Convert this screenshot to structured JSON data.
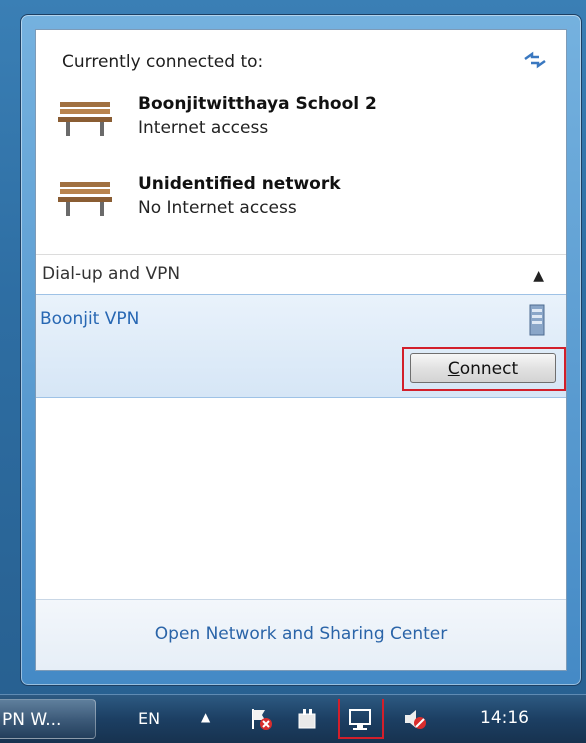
{
  "popup": {
    "current_title": "Currently connected to:",
    "networks": [
      {
        "name": "Boonjitwitthaya School  2",
        "status": "Internet access",
        "icon": "bench-network-icon"
      },
      {
        "name": "Unidentified network",
        "status": "No Internet access",
        "icon": "bench-network-icon"
      }
    ],
    "dialup_label": "Dial-up and VPN",
    "vpn": {
      "name": "Boonjit VPN",
      "button": "Connect",
      "button_accesskey": "C"
    },
    "footer_link": "Open Network and Sharing Center"
  },
  "taskbar": {
    "task_button": "PN W...",
    "language": "EN",
    "tray_icons": [
      "show-hidden-icons-arrow",
      "action-center-flag-icon",
      "power-plug-icon",
      "network-icon",
      "volume-muted-icon"
    ],
    "time": "14:16"
  },
  "colors": {
    "link_blue": "#2a64a8",
    "highlight_red": "#d21f2b",
    "vpn_selected_bg": "#dce9f7"
  }
}
